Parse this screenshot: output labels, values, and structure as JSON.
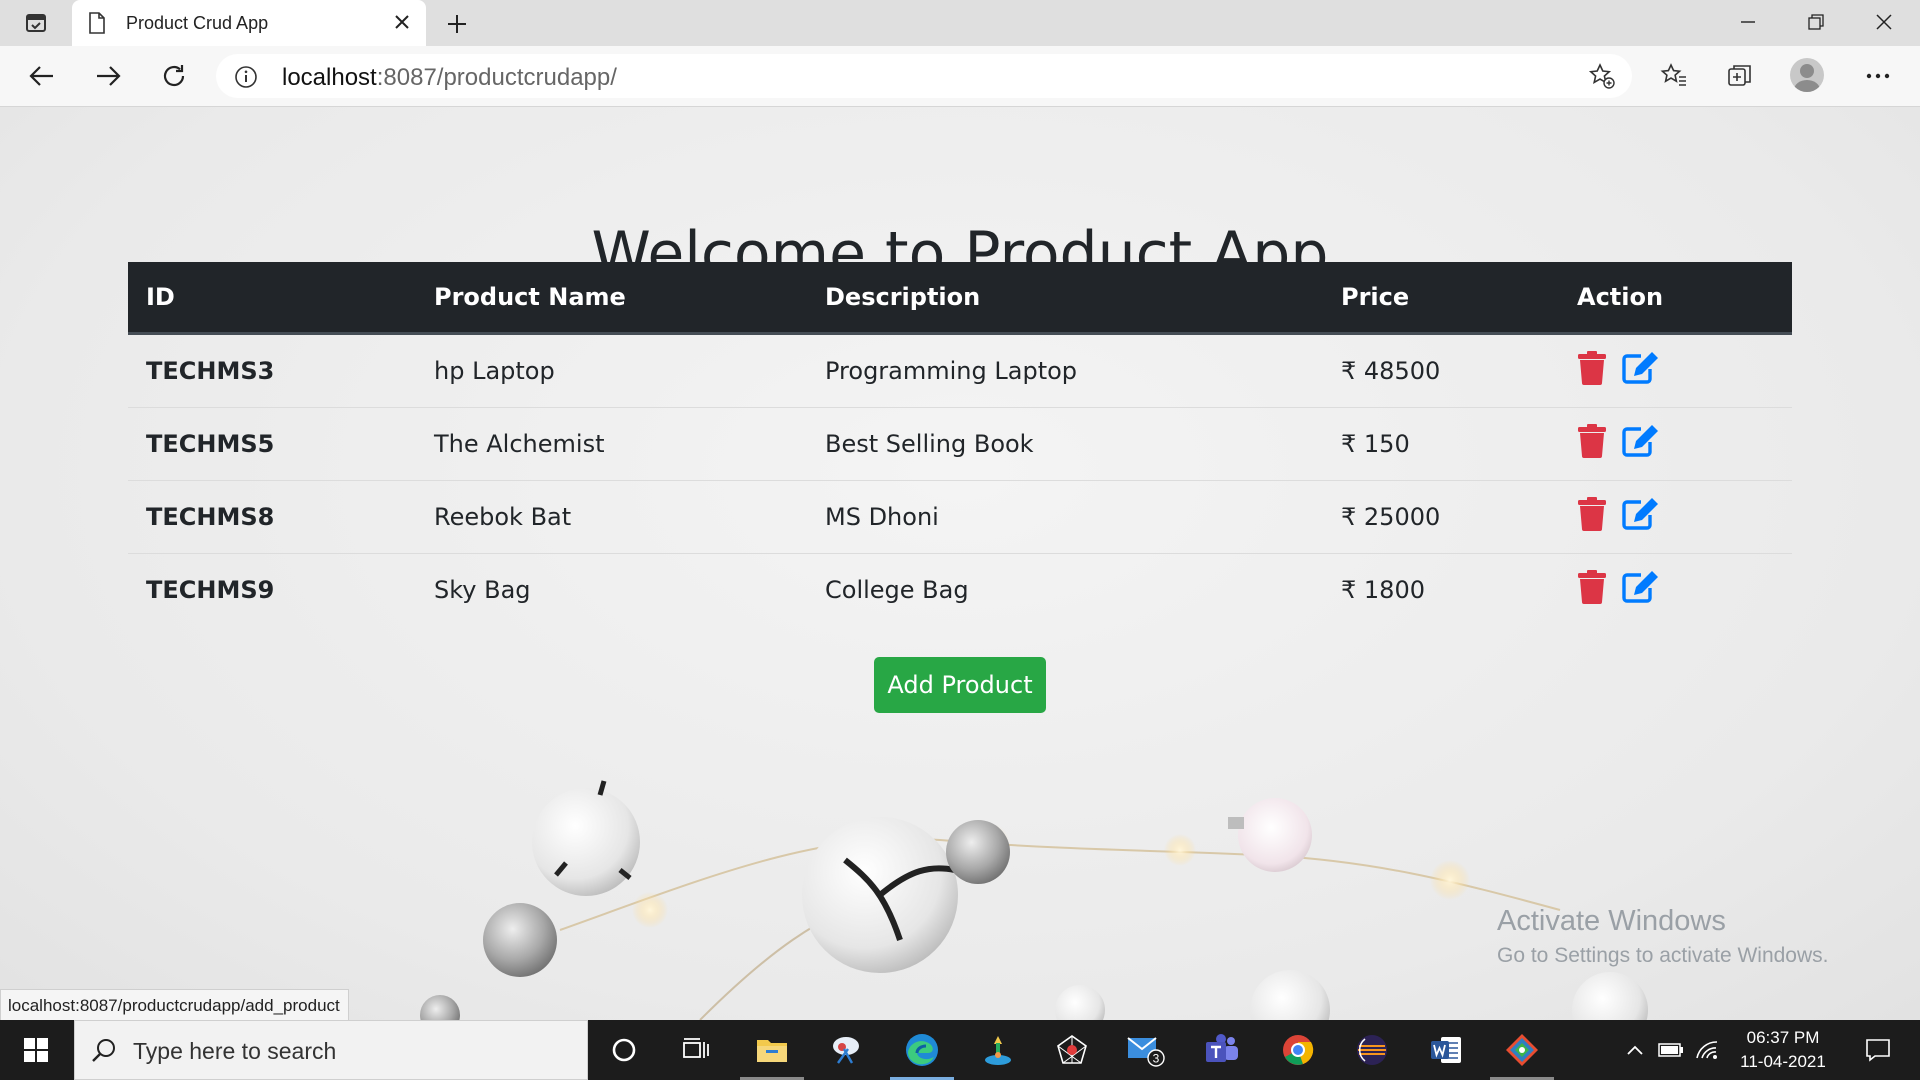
{
  "browser": {
    "tab_title": "Product Crud App",
    "url_host": "localhost",
    "url_rest": ":8087/productcrudapp/",
    "status_url": "localhost:8087/productcrudapp/add_product"
  },
  "page": {
    "title": "Welcome to Product App",
    "columns": [
      "ID",
      "Product Name",
      "Description",
      "Price",
      "Action"
    ],
    "products": [
      {
        "id": "TECHMS3",
        "name": "hp Laptop",
        "description": "Programming Laptop",
        "price": "₹ 48500"
      },
      {
        "id": "TECHMS5",
        "name": "The Alchemist",
        "description": "Best Selling Book",
        "price": "₹ 150"
      },
      {
        "id": "TECHMS8",
        "name": "Reebok Bat",
        "description": "MS Dhoni",
        "price": "₹ 25000"
      },
      {
        "id": "TECHMS9",
        "name": "Sky Bag",
        "description": "College Bag",
        "price": "₹ 1800"
      }
    ],
    "add_button_label": "Add Product",
    "delete_icon": "trash-icon",
    "edit_icon": "edit-icon",
    "colors": {
      "header_bg": "#212529",
      "delete": "#dc3545",
      "edit": "#007bff",
      "add_button": "#28a745"
    }
  },
  "watermark": {
    "line1": "Activate Windows",
    "line2": "Go to Settings to activate Windows."
  },
  "taskbar": {
    "search_placeholder": "Type here to search",
    "mail_badge": "3",
    "time": "06:37 PM",
    "date": "11-04-2021"
  }
}
